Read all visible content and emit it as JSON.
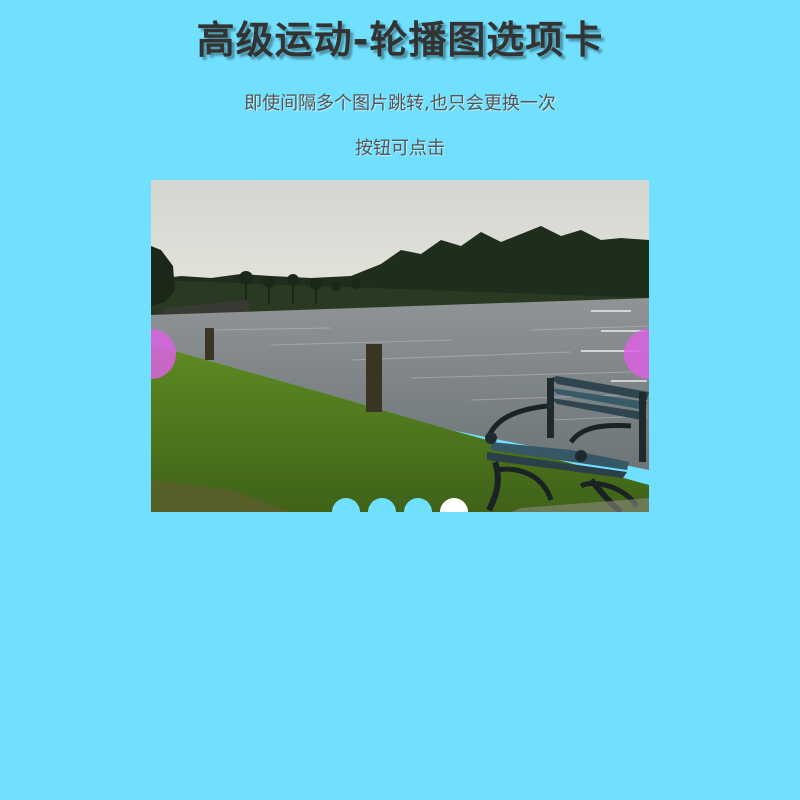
{
  "header": {
    "title": "高级运动-轮播图选项卡",
    "subtitle_1": "即使间隔多个图片跳转,也只会更换一次",
    "subtitle_2": "按钮可点击"
  },
  "carousel": {
    "active_index": 3,
    "slide_count": 4,
    "current_slide": {
      "scene": "lakeside-park-bench"
    },
    "prev_arrow_icon": "circle-arrow-left",
    "next_arrow_icon": "circle-arrow-right"
  },
  "colors": {
    "background": "#71dffe",
    "arrow": "#da62e2",
    "dot_inactive": "#71dffe",
    "dot_active": "#ffffff"
  }
}
